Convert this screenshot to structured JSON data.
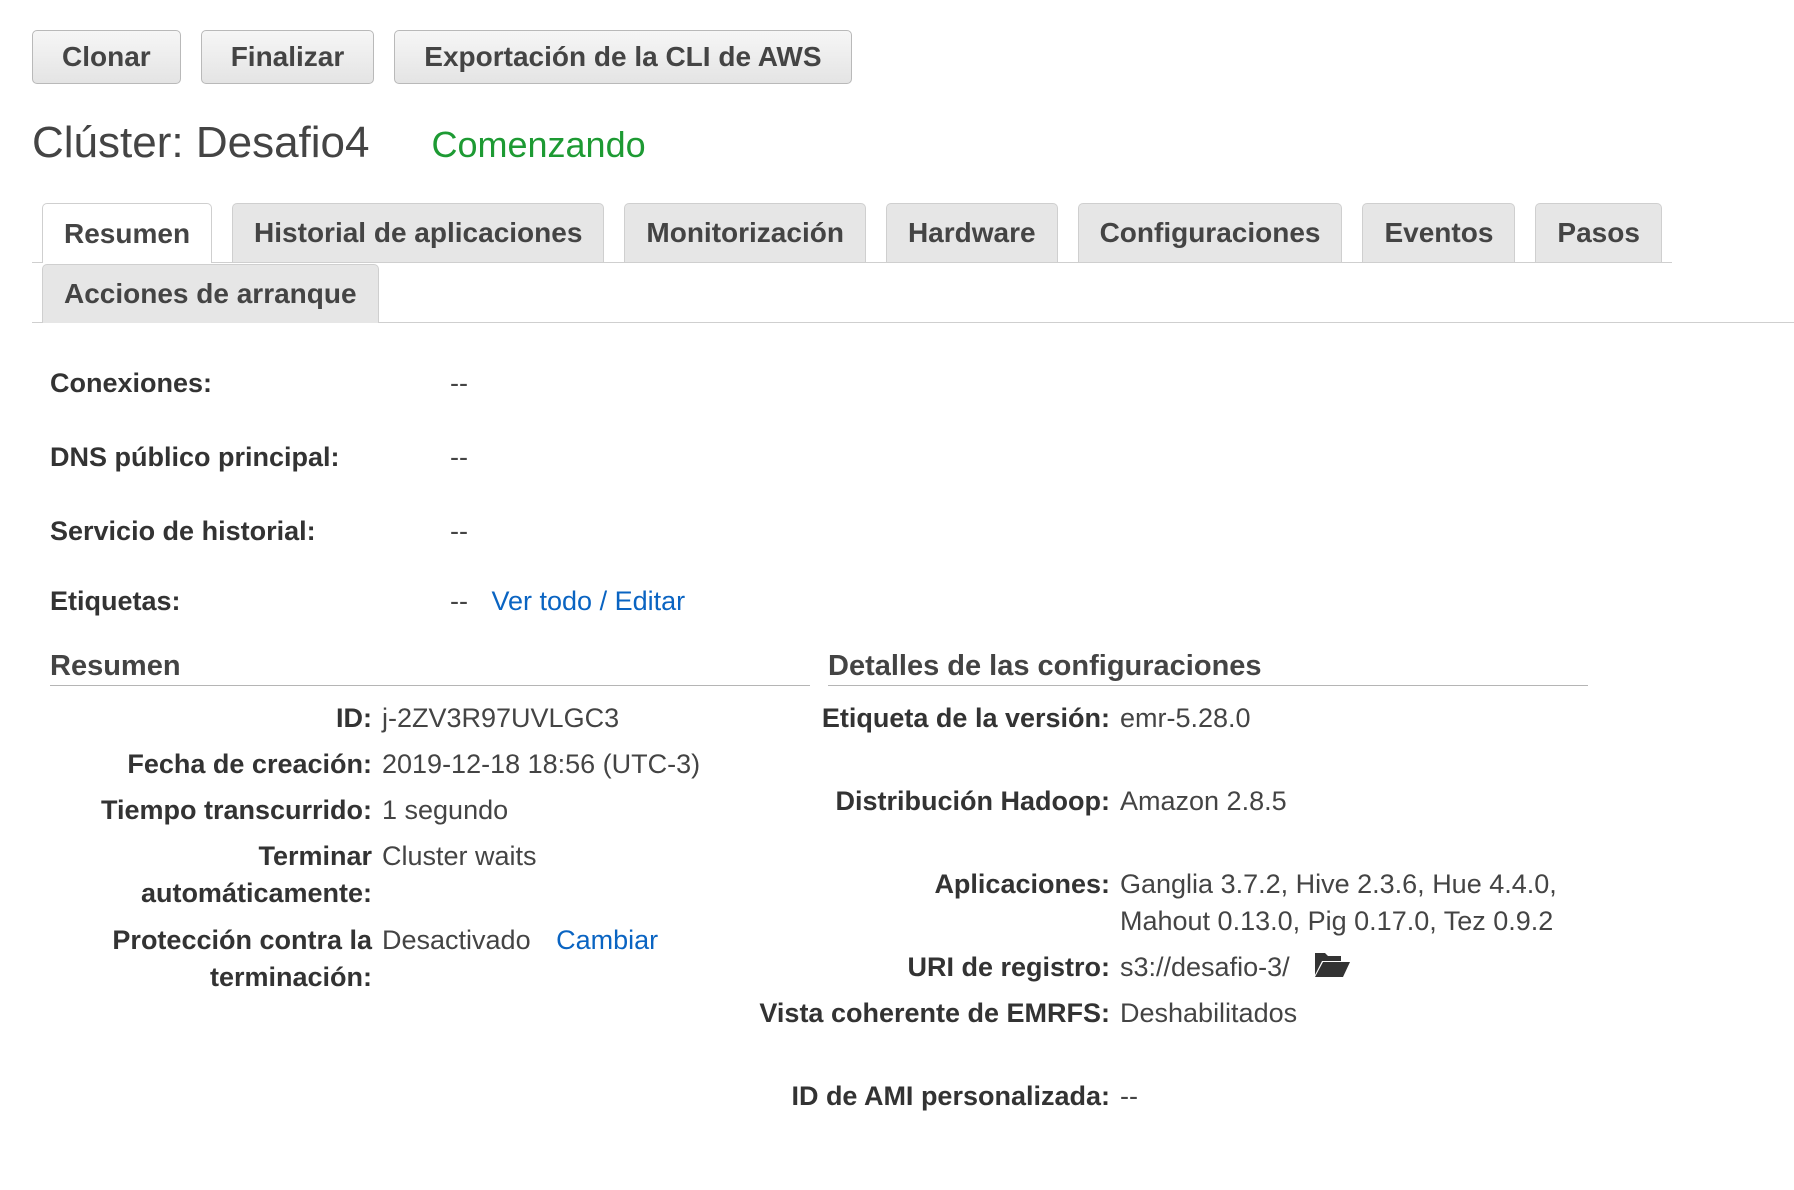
{
  "toolbar": {
    "clone_label": "Clonar",
    "terminate_label": "Finalizar",
    "cli_export_label": "Exportación de la CLI de AWS"
  },
  "cluster": {
    "title": "Clúster: Desafio4",
    "status": "Comenzando",
    "status_color": "#1d9a33"
  },
  "tabs": [
    {
      "label": "Resumen",
      "active": true
    },
    {
      "label": "Historial de aplicaciones",
      "active": false
    },
    {
      "label": "Monitorización",
      "active": false
    },
    {
      "label": "Hardware",
      "active": false
    },
    {
      "label": "Configuraciones",
      "active": false
    },
    {
      "label": "Eventos",
      "active": false
    },
    {
      "label": "Pasos",
      "active": false
    },
    {
      "label": "Acciones de arranque",
      "active": false
    }
  ],
  "info": {
    "connections": {
      "label": "Conexiones:",
      "value": "--"
    },
    "master_dns": {
      "label": "DNS público principal:",
      "value": "--"
    },
    "history_service": {
      "label": "Servicio de historial:",
      "value": "--"
    },
    "tags": {
      "label": "Etiquetas:",
      "value": "--",
      "link": "Ver todo / Editar"
    }
  },
  "summary": {
    "heading": "Resumen",
    "id": {
      "label": "ID:",
      "value": "j-2ZV3R97UVLGC3"
    },
    "created": {
      "label": "Fecha de creación:",
      "value": "2019-12-18 18:56 (UTC-3)"
    },
    "elapsed": {
      "label": "Tiempo transcurrido:",
      "value": "1 segundo"
    },
    "auto_terminate": {
      "label": "Terminar automáticamente:",
      "value": "Cluster waits"
    },
    "termination_protection": {
      "label": "Protección contra la terminación:",
      "value": "Desactivado",
      "link": "Cambiar"
    }
  },
  "config": {
    "heading": "Detalles de las configuraciones",
    "release": {
      "label": "Etiqueta de la versión:",
      "value": "emr-5.28.0"
    },
    "hadoop": {
      "label": "Distribución Hadoop:",
      "value": "Amazon 2.8.5"
    },
    "applications": {
      "label": "Aplicaciones:",
      "value": "Ganglia 3.7.2, Hive 2.3.6, Hue 4.4.0, Mahout 0.13.0, Pig 0.17.0, Tez 0.9.2"
    },
    "log_uri": {
      "label": "URI de registro:",
      "value": "s3://desafio-3/",
      "icon": "folder-open-icon"
    },
    "emrfs": {
      "label": "Vista coherente de EMRFS:",
      "value": "Deshabilitados"
    },
    "custom_ami": {
      "label": "ID de AMI personalizada:",
      "value": "--"
    }
  }
}
